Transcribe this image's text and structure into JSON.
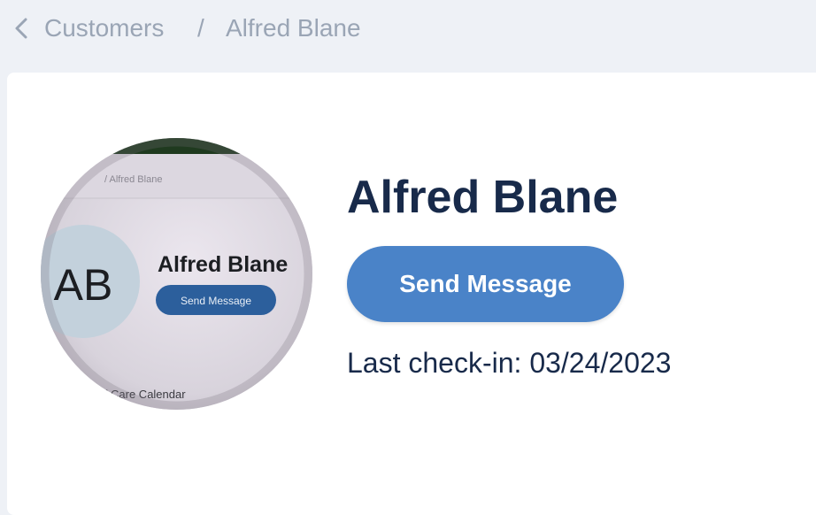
{
  "breadcrumb": {
    "back_icon": "chevron-left-icon",
    "parent": "Customers",
    "separator": "/",
    "current": "Alfred Blane"
  },
  "profile": {
    "name": "Alfred Blane",
    "send_message_label": "Send Message",
    "last_checkin": "Last check-in: 03/24/2023",
    "accent_color": "#4a83c8",
    "photo": {
      "breadcrumb_text": "/  Alfred Blane",
      "initials": "AB",
      "name": "Alfred Blane",
      "button_label": "Send Message",
      "tabs_text": "rcle of Care   Calendar"
    }
  }
}
